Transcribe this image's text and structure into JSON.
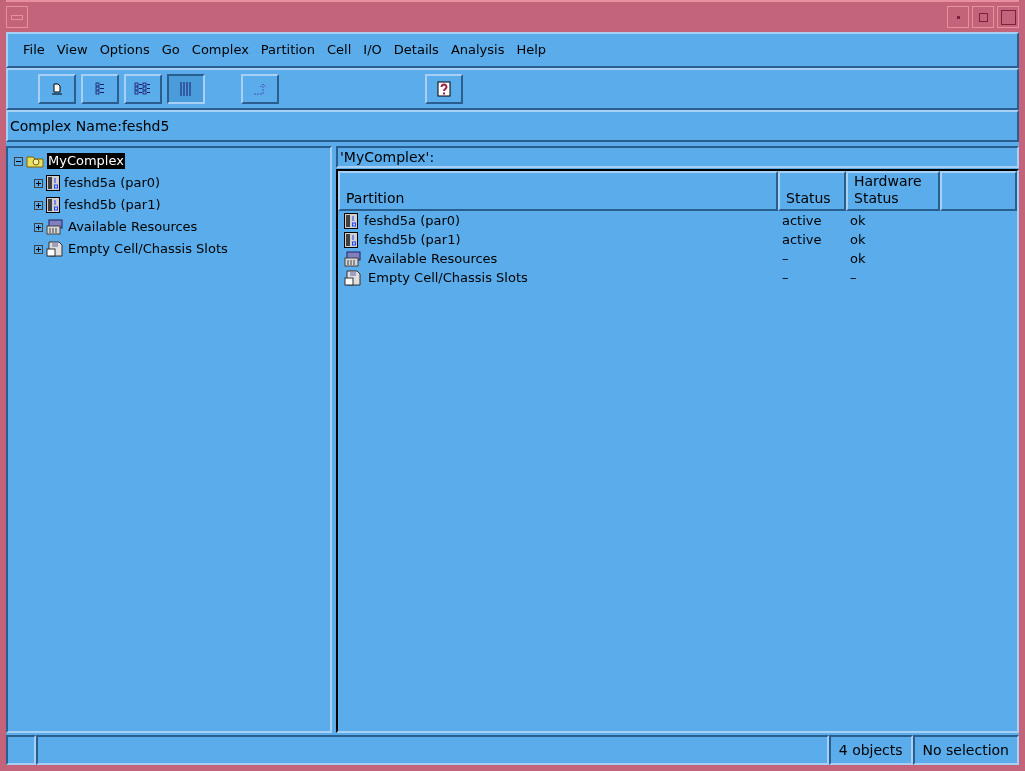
{
  "menu": [
    "File",
    "View",
    "Options",
    "Go",
    "Complex",
    "Partition",
    "Cell",
    "I/O",
    "Details",
    "Analysis",
    "Help"
  ],
  "toolbar": [
    {
      "kind": "page",
      "selected": false
    },
    {
      "kind": "list",
      "selected": false
    },
    {
      "kind": "icons",
      "selected": false
    },
    {
      "kind": "details",
      "selected": true
    },
    {
      "kind": "up",
      "selected": false
    },
    {
      "kind": "help",
      "selected": false
    }
  ],
  "complex_name": "Complex Name:feshd5",
  "tree": [
    {
      "label": "MyComplex",
      "kind": "complex",
      "selected": true,
      "expanded": true,
      "children": [
        {
          "label": "feshd5a (par0)",
          "kind": "partition",
          "selected": false,
          "expanded": false
        },
        {
          "label": "feshd5b (par1)",
          "kind": "partition",
          "selected": false,
          "expanded": false
        },
        {
          "label": "Available Resources",
          "kind": "resources",
          "selected": false,
          "expanded": false
        },
        {
          "label": "Empty Cell/Chassis Slots",
          "kind": "slots",
          "selected": false,
          "expanded": false
        }
      ]
    }
  ],
  "list_title": "'MyComplex':",
  "table": {
    "columns": [
      "Partition",
      "Status",
      "Hardware Status"
    ],
    "rows": [
      {
        "kind": "partition",
        "cells": [
          "feshd5a (par0)",
          "active",
          "ok"
        ]
      },
      {
        "kind": "partition",
        "cells": [
          "feshd5b (par1)",
          "active",
          "ok"
        ]
      },
      {
        "kind": "resources",
        "cells": [
          "Available Resources",
          "–",
          "ok"
        ]
      },
      {
        "kind": "slots",
        "cells": [
          "Empty Cell/Chassis Slots",
          "–",
          "–"
        ]
      }
    ]
  },
  "status_bar": [
    "4 objects",
    "No selection"
  ]
}
